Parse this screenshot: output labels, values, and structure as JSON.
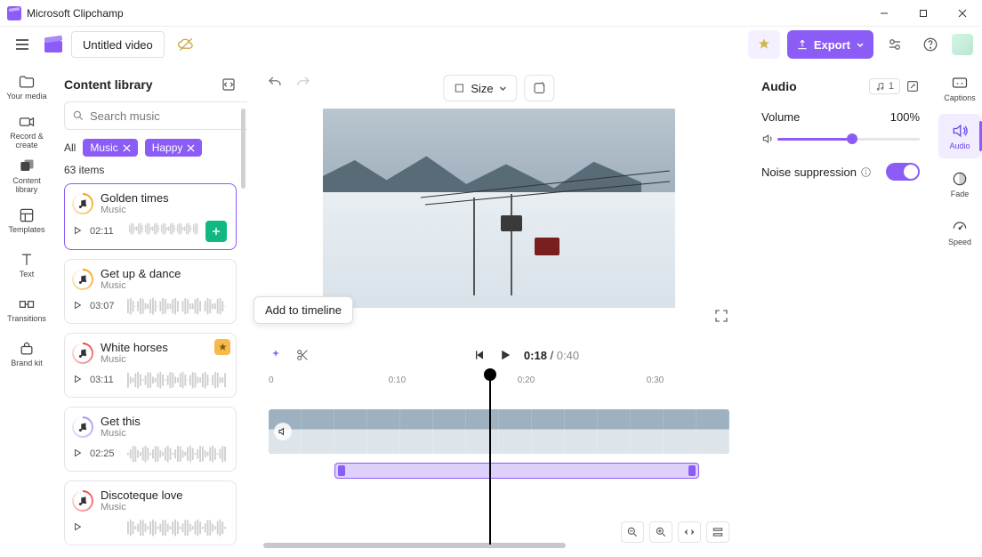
{
  "app": {
    "title": "Microsoft Clipchamp",
    "project": "Untitled video"
  },
  "topbar": {
    "export": "Export"
  },
  "rail": {
    "items": [
      {
        "label": "Your media"
      },
      {
        "label": "Record & create"
      },
      {
        "label": "Content library"
      },
      {
        "label": "Templates"
      },
      {
        "label": "Text"
      },
      {
        "label": "Transitions"
      },
      {
        "label": "Brand kit"
      }
    ]
  },
  "library": {
    "title": "Content library",
    "search_placeholder": "Search music",
    "chip_all": "All",
    "chips": [
      "Music",
      "Happy"
    ],
    "count": "63 items",
    "tooltip": "Add to timeline",
    "items": [
      {
        "title": "Golden times",
        "sub": "Music",
        "dur": "02:11",
        "selected": true,
        "ring": "#f59e0b"
      },
      {
        "title": "Get up & dance",
        "sub": "Music",
        "dur": "03:07",
        "ring": "#f59e0b"
      },
      {
        "title": "White horses",
        "sub": "Music",
        "dur": "03:11",
        "premium": true,
        "ring": "#ef4444"
      },
      {
        "title": "Get this",
        "sub": "Music",
        "dur": "02:25",
        "ring": "#a78bfa"
      },
      {
        "title": "Discoteque love",
        "sub": "Music",
        "dur": "",
        "ring": "#ef4444"
      }
    ]
  },
  "preview": {
    "size_label": "Size"
  },
  "timeline": {
    "current": "0:18",
    "total": "0:40",
    "ticks": [
      {
        "label": "0",
        "pct": 0
      },
      {
        "label": "0:10",
        "pct": 26
      },
      {
        "label": "0:20",
        "pct": 54
      },
      {
        "label": "0:30",
        "pct": 82
      }
    ]
  },
  "audio": {
    "title": "Audio",
    "badge": "1",
    "volume_label": "Volume",
    "volume_value": "100%",
    "volume_pct": 50,
    "noise_label": "Noise suppression"
  },
  "rrail": {
    "items": [
      {
        "label": "Captions"
      },
      {
        "label": "Audio"
      },
      {
        "label": "Fade"
      },
      {
        "label": "Speed"
      }
    ]
  }
}
